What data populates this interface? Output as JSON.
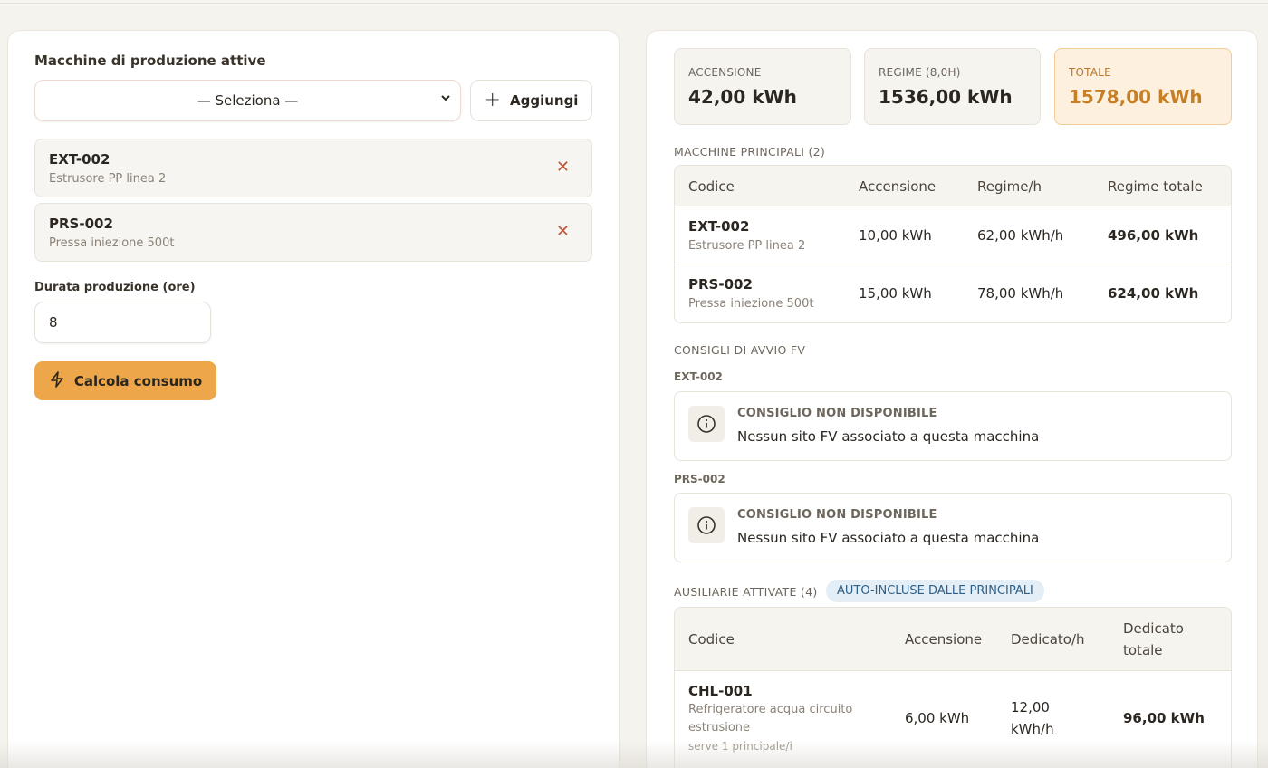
{
  "left": {
    "section_title": "Macchine di produzione attive",
    "select_value": "— Seleziona —",
    "add_label": "Aggiungi",
    "machines": [
      {
        "code": "EXT-002",
        "desc": "Estrusore PP linea 2"
      },
      {
        "code": "PRS-002",
        "desc": "Pressa iniezione 500t"
      }
    ],
    "duration_label": "Durata produzione (ore)",
    "duration_value": "8",
    "calc_label": "Calcola consumo"
  },
  "stats": {
    "startup_label": "ACCENSIONE",
    "startup_value": "42,00 kWh",
    "regime_label": "REGIME (8,0H)",
    "regime_value": "1536,00 kWh",
    "total_label": "TOTALE",
    "total_value": "1578,00 kWh"
  },
  "main_machines": {
    "heading": "MACCHINE PRINCIPALI (2)",
    "columns": [
      "Codice",
      "Accensione",
      "Regime/h",
      "Regime totale"
    ],
    "rows": [
      {
        "code": "EXT-002",
        "desc": "Estrusore PP linea 2",
        "startup": "10,00 kWh",
        "rate": "62,00 kWh/h",
        "total": "496,00 kWh"
      },
      {
        "code": "PRS-002",
        "desc": "Pressa iniezione 500t",
        "startup": "15,00 kWh",
        "rate": "78,00 kWh/h",
        "total": "624,00 kWh"
      }
    ]
  },
  "advice": {
    "heading": "CONSIGLI DI AVVIO FV",
    "items": [
      {
        "machine": "EXT-002",
        "title": "CONSIGLIO NON DISPONIBILE",
        "text": "Nessun sito FV associato a questa macchina"
      },
      {
        "machine": "PRS-002",
        "title": "CONSIGLIO NON DISPONIBILE",
        "text": "Nessun sito FV associato a questa macchina"
      }
    ]
  },
  "aux": {
    "heading": "AUSILIARIE ATTIVATE (4)",
    "badge": "AUTO-INCLUSE DALLE PRINCIPALI",
    "columns": [
      "Codice",
      "Accensione",
      "Dedicato/h",
      "Dedicato",
      "totale"
    ],
    "rows": [
      {
        "code": "CHL-001",
        "desc_line1": "Refrigeratore acqua circuito",
        "desc_line2": "estrusione",
        "note": "serve 1 principale/i",
        "startup": "6,00 kWh",
        "rate_line1": "12,00",
        "rate_line2": "kWh/h",
        "total": "96,00 kWh"
      }
    ]
  }
}
